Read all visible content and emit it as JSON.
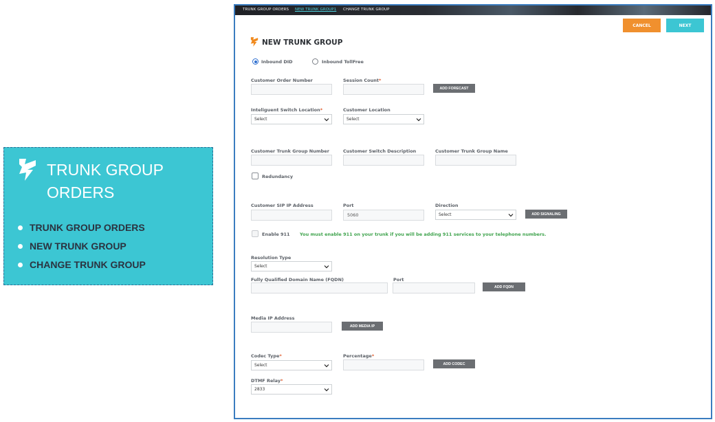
{
  "side_panel": {
    "title": "TRUNK GROUP ORDERS",
    "items": [
      {
        "label": "TRUNK GROUP ORDERS"
      },
      {
        "label": "NEW TRUNK GROUP"
      },
      {
        "label": "CHANGE TRUNK GROUP"
      }
    ]
  },
  "breadcrumb": {
    "items": [
      "TRUNK GROUP ORDERS",
      "NEW TRUNK GROUP1",
      "CHANGE TRUNK GROUP"
    ]
  },
  "actions": {
    "cancel": "CANCEL",
    "next": "NEXT"
  },
  "page_title": "NEW TRUNK GROUP",
  "order_type": {
    "options": [
      "Inbound DID",
      "Inbound TollFree"
    ],
    "selected": "Inbound DID"
  },
  "fields": {
    "customer_order_number": {
      "label": "Customer Order Number",
      "value": ""
    },
    "session_count": {
      "label": "Session Count",
      "required_mark": "*",
      "value": ""
    },
    "intelligent_switch_location": {
      "label": "Inteliguent Switch Location",
      "required_mark": "*",
      "value": "Select"
    },
    "customer_location": {
      "label": "Customer Location",
      "value": "Select"
    },
    "customer_trunk_group_number": {
      "label": "Customer Trunk Group Number",
      "value": ""
    },
    "customer_switch_description": {
      "label": "Customer Switch Description",
      "value": ""
    },
    "customer_trunk_group_name": {
      "label": "Customer Trunk Group Name",
      "value": ""
    },
    "redundancy": {
      "label": "Redundancy",
      "checked": false
    },
    "customer_sip_ip": {
      "label": "Customer SIP IP Address",
      "value": ""
    },
    "sip_port": {
      "label": "Port",
      "value": "5060"
    },
    "direction": {
      "label": "Direction",
      "value": "Select"
    },
    "enable_911": {
      "label": "Enable 911",
      "checked": false
    },
    "enable_911_note": "You must enable 911 on your trunk if you will be adding 911 services to your telephone numbers.",
    "resolution_type": {
      "label": "Resolution Type",
      "value": "Select"
    },
    "fqdn": {
      "label": "Fully Qualified Domain Name (FQDN)",
      "value": ""
    },
    "fqdn_port": {
      "label": "Port",
      "value": ""
    },
    "media_ip": {
      "label": "Media IP Address",
      "value": ""
    },
    "codec_type": {
      "label": "Codec Type",
      "required_mark": "*",
      "value": "Select"
    },
    "percentage": {
      "label": "Percentage",
      "required_mark": "*",
      "value": ""
    },
    "dtmf_relay": {
      "label": "DTMF Relay",
      "required_mark": "*",
      "value": "2833"
    }
  },
  "buttons": {
    "add_forecast": "ADD FORECAST",
    "add_signaling": "ADD SIGNALING",
    "add_fqdn": "ADD FQDN",
    "add_media_ip": "ADD MEDIA IP",
    "add_codec": "ADD CODEC"
  },
  "colors": {
    "teal": "#3cc6d3",
    "orange": "#f0902e",
    "logo_orange": "#f08a1e",
    "frame_blue": "#3a7cbf",
    "note_green": "#3fa34d"
  },
  "icons": {
    "logo": "intelliquent-logo-icon",
    "dropdown": "chevron-down-icon"
  }
}
